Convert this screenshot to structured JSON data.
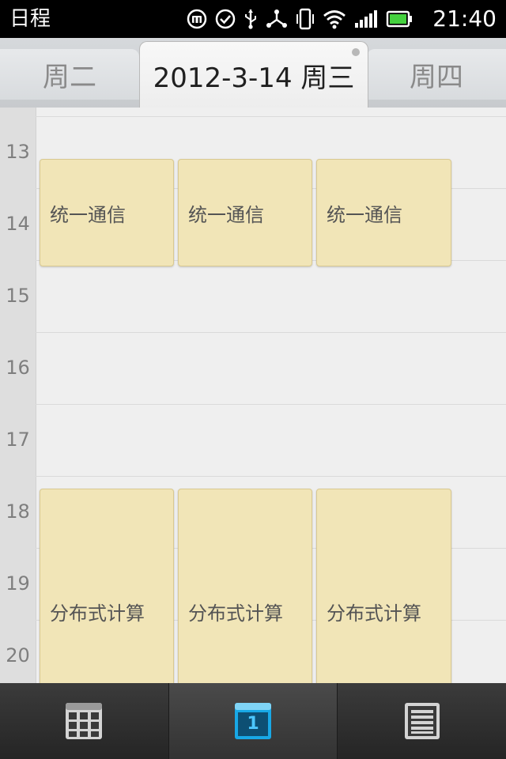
{
  "status_bar": {
    "app_title": "日程",
    "time": "21:40",
    "icons": [
      "mi-icon",
      "check-circle-icon",
      "usb-icon",
      "share-icon",
      "vibrate-icon",
      "wifi-icon",
      "signal-icon",
      "battery-icon"
    ]
  },
  "day_tabs": {
    "prev": "周二",
    "current": "2012-3-14 周三",
    "next": "周四"
  },
  "hours": [
    "13",
    "14",
    "15",
    "16",
    "17",
    "18",
    "19",
    "20"
  ],
  "events": [
    {
      "title": "统一通信"
    },
    {
      "title": "统一通信"
    },
    {
      "title": "统一通信"
    },
    {
      "title": "分布式计算"
    },
    {
      "title": "分布式计算"
    },
    {
      "title": "分布式计算"
    }
  ],
  "bottom_nav": {
    "items": [
      {
        "icon": "month-grid-icon",
        "active": false
      },
      {
        "icon": "day-calendar-icon",
        "label": "1",
        "active": true
      },
      {
        "icon": "agenda-list-icon",
        "active": false
      }
    ]
  },
  "colors": {
    "event_bg": "#f1e5b7",
    "accent_blue": "#18a8e6",
    "nav_bg": "#2d2d2d"
  }
}
